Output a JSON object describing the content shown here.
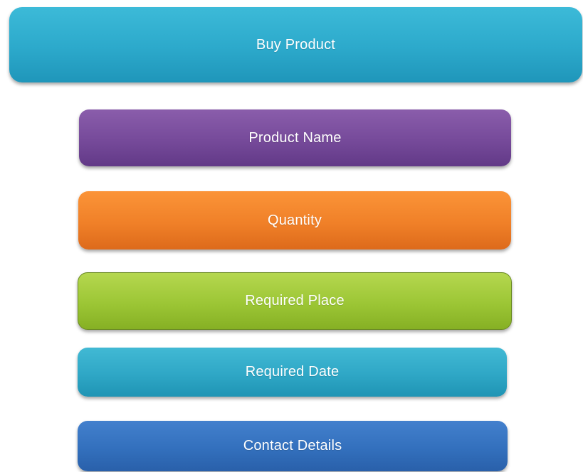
{
  "boxes": {
    "buy_product": "Buy Product",
    "product_name": "Product Name",
    "quantity": "Quantity",
    "required_place": "Required Place",
    "required_date": "Required Date",
    "contact_details": "Contact Details"
  },
  "colors": {
    "buy_product": "#2ca9cb",
    "product_name": "#764a9a",
    "quantity": "#f08028",
    "required_place": "#9cc635",
    "required_date": "#2fa7c6",
    "contact_details": "#3370bd"
  }
}
